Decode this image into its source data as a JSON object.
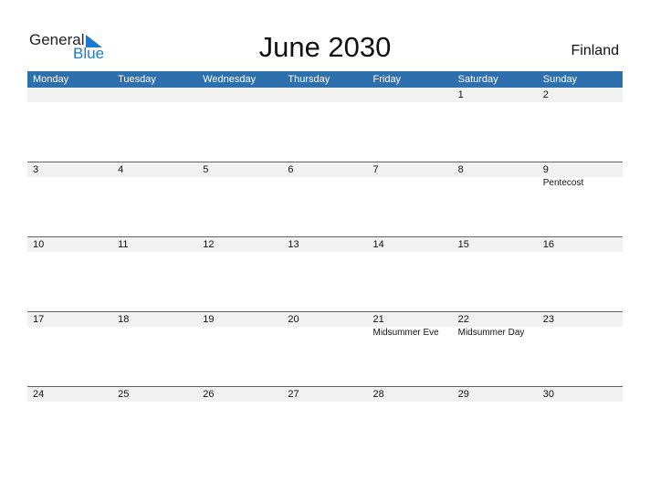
{
  "logo": {
    "line1": "General",
    "line2": "Blue"
  },
  "title": "June 2030",
  "country": "Finland",
  "weekdays": [
    "Monday",
    "Tuesday",
    "Wednesday",
    "Thursday",
    "Friday",
    "Saturday",
    "Sunday"
  ],
  "weeks": [
    {
      "days": [
        "",
        "",
        "",
        "",
        "",
        "1",
        "2"
      ],
      "holidays": [
        "",
        "",
        "",
        "",
        "",
        "",
        ""
      ]
    },
    {
      "days": [
        "3",
        "4",
        "5",
        "6",
        "7",
        "8",
        "9"
      ],
      "holidays": [
        "",
        "",
        "",
        "",
        "",
        "",
        "Pentecost"
      ]
    },
    {
      "days": [
        "10",
        "11",
        "12",
        "13",
        "14",
        "15",
        "16"
      ],
      "holidays": [
        "",
        "",
        "",
        "",
        "",
        "",
        ""
      ]
    },
    {
      "days": [
        "17",
        "18",
        "19",
        "20",
        "21",
        "22",
        "23"
      ],
      "holidays": [
        "",
        "",
        "",
        "",
        "Midsummer Eve",
        "Midsummer Day",
        ""
      ]
    },
    {
      "days": [
        "24",
        "25",
        "26",
        "27",
        "28",
        "29",
        "30"
      ],
      "holidays": [
        "",
        "",
        "",
        "",
        "",
        "",
        ""
      ]
    }
  ],
  "colors": {
    "accent": "#2e6fad",
    "brand": "#1a7bd0",
    "band": "#f1f1f1"
  }
}
